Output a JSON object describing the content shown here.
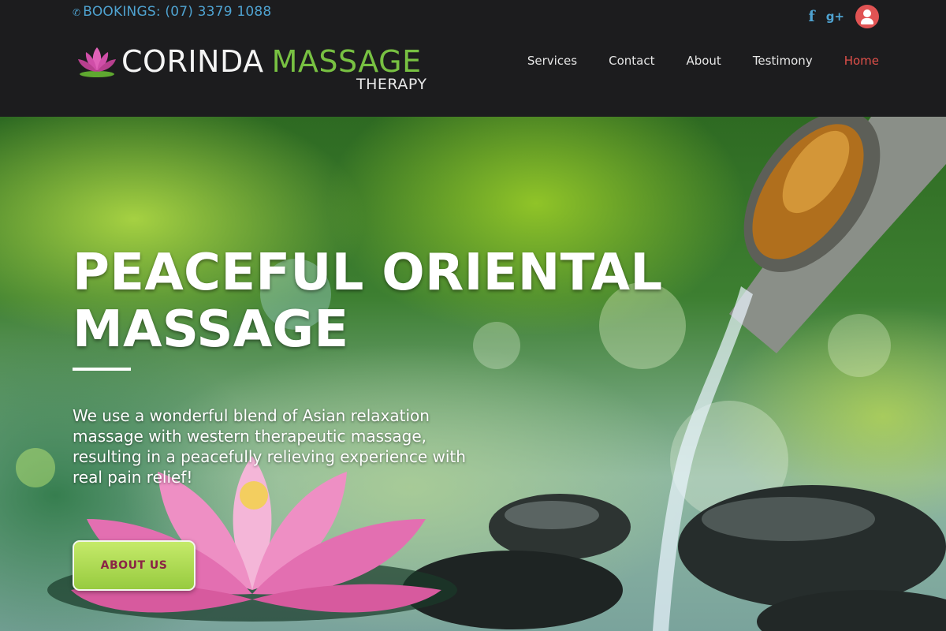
{
  "topbar": {
    "booking_text": "BOOKINGS: (07) 3379 1088",
    "phone_icon": "phone-icon",
    "social": [
      {
        "name": "facebook",
        "icon": "facebook-icon",
        "glyph": "f"
      },
      {
        "name": "google-plus",
        "icon": "google-plus-icon",
        "glyph": "g+"
      },
      {
        "name": "account",
        "icon": "user-icon"
      }
    ]
  },
  "logo": {
    "word1": "CORINDA",
    "word2": "MASSAGE",
    "word3": "THERAPY"
  },
  "nav": {
    "items": [
      {
        "label": "Services"
      },
      {
        "label": "Contact"
      },
      {
        "label": "About"
      },
      {
        "label": "Testimony"
      },
      {
        "label": "Home",
        "active": true
      }
    ]
  },
  "hero": {
    "title": "PEACEFUL ORIENTAL MASSAGE",
    "description": "We use a wonderful blend of Asian relaxation massage with western therapeutic massage, resulting in a peacefully relieving experience with real pain relief!",
    "button_label": "ABOUT US"
  },
  "colors": {
    "header_bg": "#1c1c1e",
    "accent_blue": "#4fa3d1",
    "logo_green": "#78c142",
    "nav_active": "#e0504a",
    "button_green": "#a6d64f",
    "button_text": "#8b2346"
  }
}
